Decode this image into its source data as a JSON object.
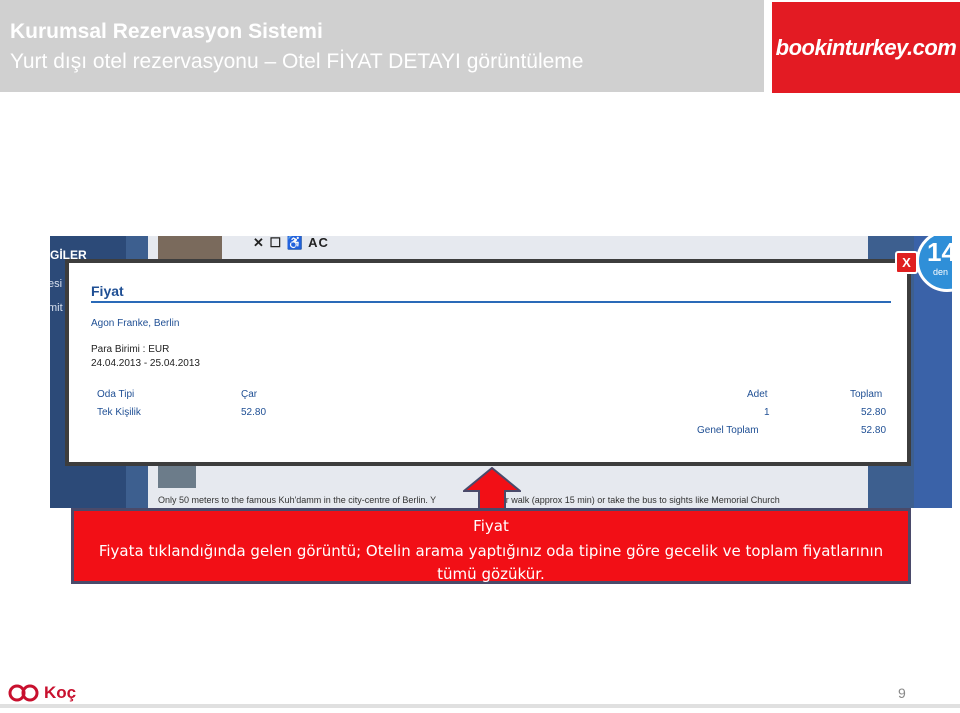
{
  "header": {
    "title": "Kurumsal Rezervasyon Sistemi",
    "subtitle": "Yurt dışı otel rezervasyonu – Otel FİYAT DETAYI görüntüleme",
    "logo_text": "bookinturkey.com",
    "logo_color": "#e31b23"
  },
  "background_screen": {
    "sidebar_heading": "GİLER",
    "sidebar_item_1": "esi",
    "sidebar_item_2": "mit",
    "amenity_icons": "✕ ☐ ♿ AC",
    "badge_number": "14",
    "badge_small": "den",
    "description_left": "Only 50 meters to the famous Kuh'damm in the city-centre of Berlin. Y",
    "description_right": "either walk (approx 15 min) or take the bus to sights like Memorial Church"
  },
  "popup": {
    "close_label": "X",
    "title": "Fiyat",
    "hotel_name": "Agon Franke, Berlin",
    "currency": "Para Birimi : EUR",
    "dates": "24.04.2013 - 25.04.2013",
    "table": {
      "headers": {
        "room_type": "Oda Tipi",
        "day": "Çar",
        "count": "Adet",
        "total": "Toplam"
      },
      "row": {
        "room_type": "Tek Kişilik",
        "day": "52.80",
        "count": "1",
        "total": "52.80"
      },
      "grand_total_label": "Genel Toplam",
      "grand_total_value": "52.80"
    }
  },
  "caption": {
    "title": "Fiyat",
    "body": "Fiyata tıklandığında gelen görüntü; Otelin arama yaptığınız oda tipine göre gecelik ve toplam fiyatlarının tümü gözükür.",
    "color": "#f20f16"
  },
  "footer": {
    "brand": "Koç",
    "page_number": "9"
  }
}
